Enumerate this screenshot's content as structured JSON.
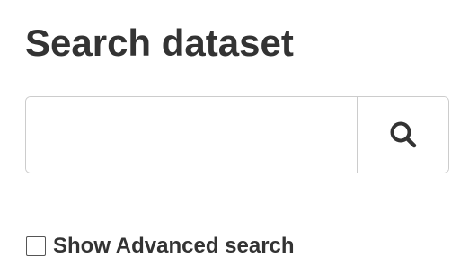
{
  "page": {
    "title": "Search dataset"
  },
  "search": {
    "value": "",
    "placeholder": "",
    "button_icon": "search-icon"
  },
  "advanced": {
    "label": "Show Advanced search",
    "checked": false
  },
  "colors": {
    "text": "#333333",
    "border": "#cccccc",
    "background": "#ffffff"
  }
}
